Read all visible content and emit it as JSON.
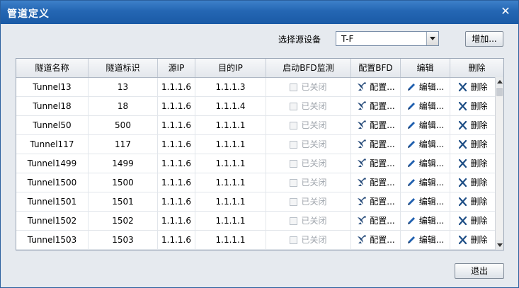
{
  "window": {
    "title": "管道定义"
  },
  "source_device": {
    "label": "选择源设备",
    "selected": "T-F"
  },
  "buttons": {
    "add": "增加...",
    "exit": "退出"
  },
  "table": {
    "columns": [
      "隧道名称",
      "隧道标识",
      "源IP",
      "目的IP",
      "启动BFD监测",
      "配置BFD",
      "编辑",
      "删除"
    ],
    "rows": [
      {
        "name": "Tunnel13",
        "id": "13",
        "src": "1.1.1.6",
        "dst": "1.1.1.3",
        "bfd": "已关闭",
        "config": "配置...",
        "edit": "编辑...",
        "del": "删除"
      },
      {
        "name": "Tunnel18",
        "id": "18",
        "src": "1.1.1.6",
        "dst": "1.1.1.4",
        "bfd": "已关闭",
        "config": "配置...",
        "edit": "编辑...",
        "del": "删除"
      },
      {
        "name": "Tunnel50",
        "id": "500",
        "src": "1.1.1.6",
        "dst": "1.1.1.1",
        "bfd": "已关闭",
        "config": "配置...",
        "edit": "编辑...",
        "del": "删除"
      },
      {
        "name": "Tunnel117",
        "id": "117",
        "src": "1.1.1.6",
        "dst": "1.1.1.1",
        "bfd": "已关闭",
        "config": "配置...",
        "edit": "编辑...",
        "del": "删除"
      },
      {
        "name": "Tunnel1499",
        "id": "1499",
        "src": "1.1.1.6",
        "dst": "1.1.1.1",
        "bfd": "已关闭",
        "config": "配置...",
        "edit": "编辑...",
        "del": "删除"
      },
      {
        "name": "Tunnel1500",
        "id": "1500",
        "src": "1.1.1.6",
        "dst": "1.1.1.1",
        "bfd": "已关闭",
        "config": "配置...",
        "edit": "编辑...",
        "del": "删除"
      },
      {
        "name": "Tunnel1501",
        "id": "1501",
        "src": "1.1.1.6",
        "dst": "1.1.1.1",
        "bfd": "已关闭",
        "config": "配置...",
        "edit": "编辑...",
        "del": "删除"
      },
      {
        "name": "Tunnel1502",
        "id": "1502",
        "src": "1.1.1.6",
        "dst": "1.1.1.1",
        "bfd": "已关闭",
        "config": "配置...",
        "edit": "编辑...",
        "del": "删除"
      },
      {
        "name": "Tunnel1503",
        "id": "1503",
        "src": "1.1.1.6",
        "dst": "1.1.1.1",
        "bfd": "已关闭",
        "config": "配置...",
        "edit": "编辑...",
        "del": "删除"
      }
    ]
  }
}
